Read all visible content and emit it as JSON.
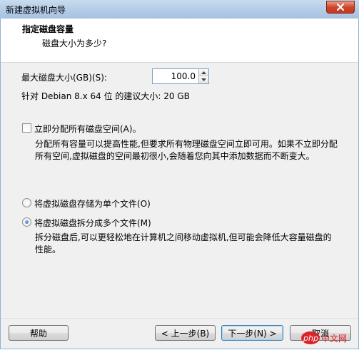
{
  "window": {
    "title": "新建虚拟机向导"
  },
  "header": {
    "title": "指定磁盘容量",
    "subtitle": "磁盘大小为多少?"
  },
  "disk_size": {
    "label": "最大磁盘大小(GB)(S):",
    "value": "100.0",
    "recommendation": "针对 Debian 8.x 64 位 的建议大小: 20 GB"
  },
  "allocate": {
    "label": "立即分配所有磁盘空间(A)。",
    "checked": false,
    "description_line1": "分配所有容量可以提高性能,但要求所有物理磁盘空间立即可用。如果不立即分配",
    "description_line2": "所有空间,虚拟磁盘的空间最初很小,会随着您向其中添加数据而不断变大。"
  },
  "storage_options": [
    {
      "label": "将虚拟磁盘存储为单个文件(O)",
      "selected": false
    },
    {
      "label": "将虚拟磁盘拆分成多个文件(M)",
      "selected": true
    }
  ],
  "split_description_line1": "拆分磁盘后,可以更轻松地在计算机之间移动虚拟机,但可能会降低大容量磁盘的",
  "split_description_line2": "性能。",
  "buttons": {
    "help": "帮助",
    "back": "< 上一步(B)",
    "next": "下一步(N) >",
    "cancel": "取消"
  },
  "watermark": {
    "text": "php 中文网",
    "color": "#d9242a"
  },
  "colors": {
    "accent": "#3c7fb1",
    "close": "#c23a22"
  }
}
